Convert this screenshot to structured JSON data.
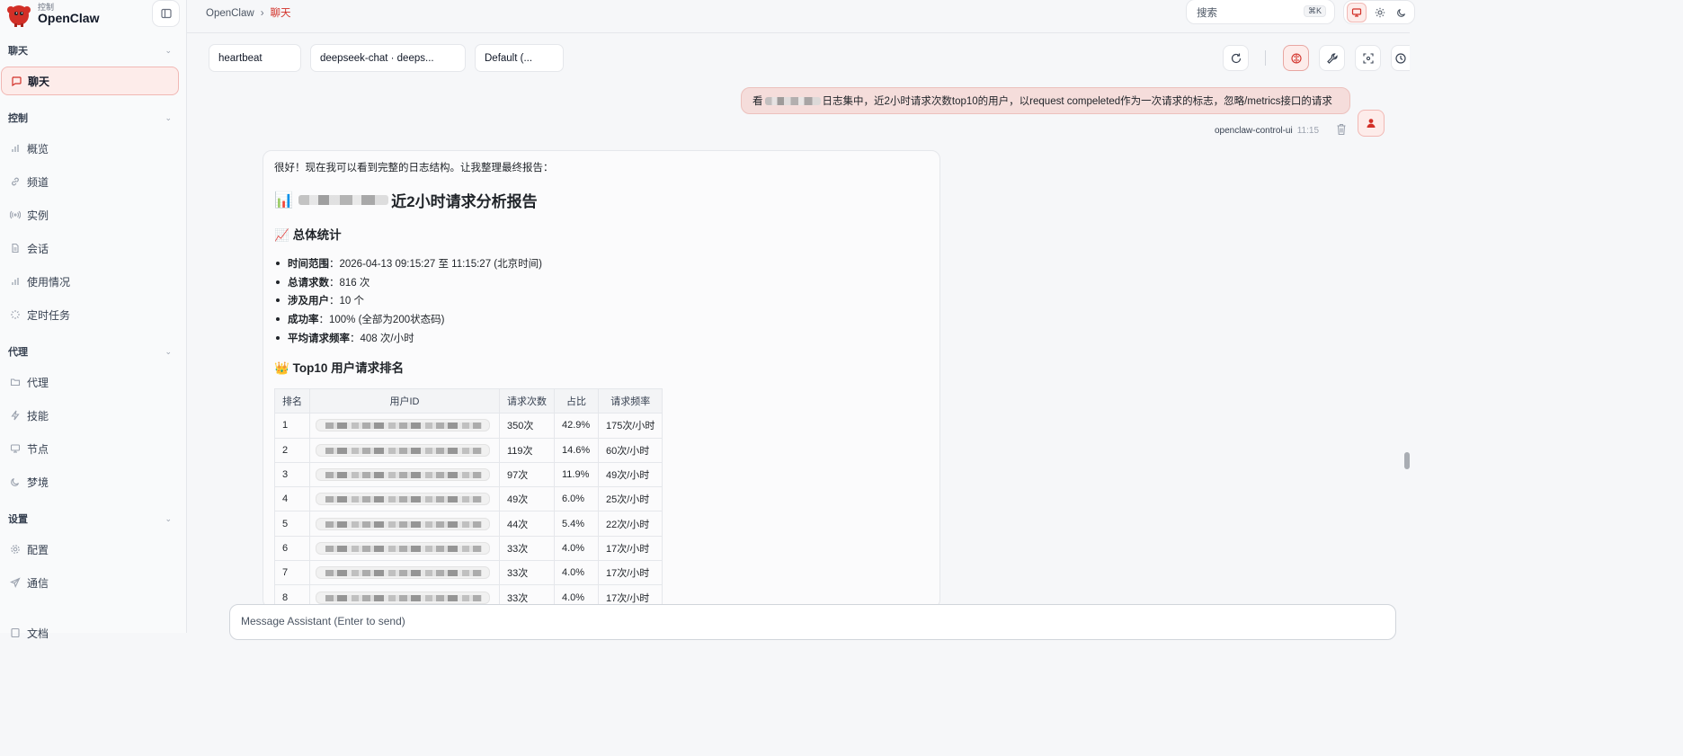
{
  "brand": {
    "subtitle": "控制",
    "name": "OpenClaw"
  },
  "sidebar": {
    "sections": [
      {
        "title": "聊天",
        "items": [
          {
            "label": "聊天",
            "icon": "chat-bubble-icon",
            "active": true
          }
        ]
      },
      {
        "title": "控制",
        "items": [
          {
            "label": "概览",
            "icon": "bar-chart-icon"
          },
          {
            "label": "频道",
            "icon": "link-icon"
          },
          {
            "label": "实例",
            "icon": "radio-icon"
          },
          {
            "label": "会话",
            "icon": "document-icon"
          },
          {
            "label": "使用情况",
            "icon": "bar-chart-icon"
          },
          {
            "label": "定时任务",
            "icon": "loader-icon"
          }
        ]
      },
      {
        "title": "代理",
        "items": [
          {
            "label": "代理",
            "icon": "folder-icon"
          },
          {
            "label": "技能",
            "icon": "lightning-icon"
          },
          {
            "label": "节点",
            "icon": "monitor-icon"
          },
          {
            "label": "梦境",
            "icon": "moon-icon"
          }
        ]
      },
      {
        "title": "设置",
        "items": [
          {
            "label": "配置",
            "icon": "gear-icon"
          },
          {
            "label": "通信",
            "icon": "send-icon"
          }
        ]
      }
    ],
    "trailing_item": "文档"
  },
  "header": {
    "breadcrumb": {
      "root": "OpenClaw",
      "separator": "›",
      "current": "聊天"
    },
    "search": {
      "placeholder": "搜索",
      "shortcut": "⌘K"
    }
  },
  "toolbar": {
    "session_select": "heartbeat",
    "model_select": "deepseek-chat · deeps...",
    "agent_select": "Default (..."
  },
  "user_message": {
    "text_prefix": "看",
    "text_suffix": "日志集中，近2小时请求次数top10的用户，以request compeleted作为一次请求的标志，忽略/metrics接口的请求",
    "sender": "openclaw-control-ui",
    "time": "11:15"
  },
  "assistant_message": {
    "intro": "很好！现在我可以看到完整的日志结构。让我整理最终报告：",
    "title_emoji": "📊",
    "title_suffix": "近2小时请求分析报告",
    "stats_heading_emoji": "📈",
    "stats_heading": "总体统计",
    "stats": [
      {
        "label": "时间范围",
        "value": "2026-04-13 09:15:27 至 11:15:27 (北京时间)"
      },
      {
        "label": "总请求数",
        "value": "816 次"
      },
      {
        "label": "涉及用户",
        "value": "10 个"
      },
      {
        "label": "成功率",
        "value": "100% (全部为200状态码)"
      },
      {
        "label": "平均请求频率",
        "value": "408 次/小时"
      }
    ],
    "ranking_heading_emoji": "👑",
    "ranking_heading": "Top10 用户请求排名",
    "table": {
      "headers": [
        "排名",
        "用户ID",
        "请求次数",
        "占比",
        "请求频率"
      ],
      "rows": [
        [
          "1",
          "350次",
          "42.9%",
          "175次/小时"
        ],
        [
          "2",
          "119次",
          "14.6%",
          "60次/小时"
        ],
        [
          "3",
          "97次",
          "11.9%",
          "49次/小时"
        ],
        [
          "4",
          "49次",
          "6.0%",
          "25次/小时"
        ],
        [
          "5",
          "44次",
          "5.4%",
          "22次/小时"
        ],
        [
          "6",
          "33次",
          "4.0%",
          "17次/小时"
        ],
        [
          "7",
          "33次",
          "4.0%",
          "17次/小时"
        ],
        [
          "8",
          "33次",
          "4.0%",
          "17次/小时"
        ]
      ]
    }
  },
  "composer": {
    "placeholder": "Message Assistant (Enter to send)"
  },
  "colors": {
    "accent": "#d22f27",
    "accent_bg": "#fdecea"
  }
}
